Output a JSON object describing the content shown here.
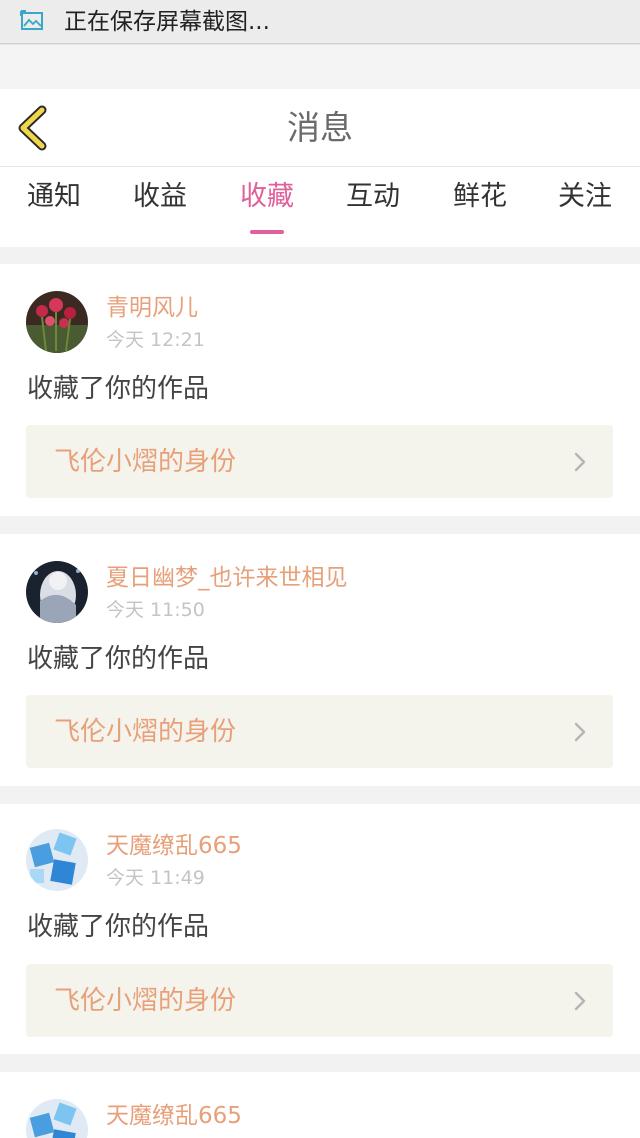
{
  "status_bar": {
    "text": "正在保存屏幕截图...",
    "icon": "screenshot-icon"
  },
  "header": {
    "title": "消息",
    "back_icon": "chevron-left-icon"
  },
  "tabs": [
    {
      "label": "通知",
      "active": false
    },
    {
      "label": "收益",
      "active": false
    },
    {
      "label": "收藏",
      "active": true
    },
    {
      "label": "互动",
      "active": false
    },
    {
      "label": "鲜花",
      "active": false
    },
    {
      "label": "关注",
      "active": false
    }
  ],
  "colors": {
    "accent": "#e0609b",
    "username": "#e8a07a",
    "work_bg": "#f4f4ec"
  },
  "messages": [
    {
      "user": "青明风儿",
      "time": "今天 12:21",
      "action": "收藏了你的作品",
      "work_title": "飞伦小熠的身份"
    },
    {
      "user": "夏日幽梦_也许来世相见",
      "time": "今天 11:50",
      "action": "收藏了你的作品",
      "work_title": "飞伦小熠的身份"
    },
    {
      "user": "天魔缭乱665",
      "time": "今天 11:49",
      "action": "收藏了你的作品",
      "work_title": "飞伦小熠的身份"
    },
    {
      "user": "天魔缭乱665"
    }
  ]
}
